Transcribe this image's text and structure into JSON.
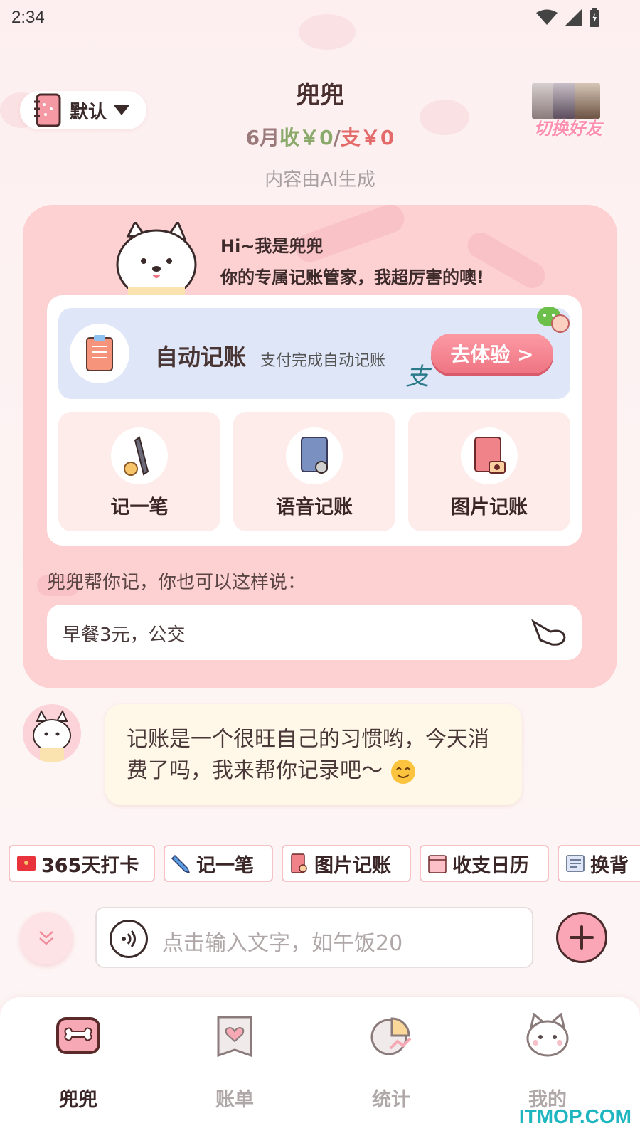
{
  "status_bar": {
    "time": "2:34"
  },
  "header": {
    "book_switch_label": "默认",
    "title": "兜兜",
    "summary_month": "6月",
    "summary_income": "收￥0",
    "summary_sep": "/",
    "summary_expense": "支￥0",
    "ai_note": "内容由AI生成",
    "friend_switch_label": "切换好友"
  },
  "card": {
    "greeting_line1": "Hi~我是兜兜",
    "greeting_line2": "你的专属记账管家，我超厉害的噢!",
    "auto": {
      "title": "自动记账",
      "subtitle": "支付完成自动记账",
      "button": "去体验 >"
    },
    "tiles": [
      {
        "label": "记一笔",
        "icon": "pen-icon"
      },
      {
        "label": "语音记账",
        "icon": "microphone-book-icon"
      },
      {
        "label": "图片记账",
        "icon": "camera-book-icon"
      }
    ],
    "hint": "兜兜帮你记，你也可以这样说：",
    "example": "早餐3元，公交"
  },
  "chat": {
    "message": "记账是一个很旺自己的习惯哟，今天消费了吗，我来帮你记录吧～"
  },
  "chips": [
    {
      "label": "365天打卡",
      "icon": "red-envelope-icon"
    },
    {
      "label": "记一笔",
      "icon": "pencil-icon"
    },
    {
      "label": "图片记账",
      "icon": "camera-book-icon"
    },
    {
      "label": "收支日历",
      "icon": "calendar-icon"
    },
    {
      "label": "换背",
      "icon": "newspaper-icon"
    }
  ],
  "input": {
    "placeholder": "点击输入文字，如午饭20"
  },
  "nav": [
    {
      "label": "兜兜",
      "active": true
    },
    {
      "label": "账单",
      "active": false
    },
    {
      "label": "统计",
      "active": false
    },
    {
      "label": "我的",
      "active": false
    }
  ],
  "watermark": "ITMOP.COM",
  "colors": {
    "accent": "#fba6b7",
    "card_bg": "#fdd0d2",
    "income": "#8ba96a",
    "expense": "#e46a6a"
  }
}
